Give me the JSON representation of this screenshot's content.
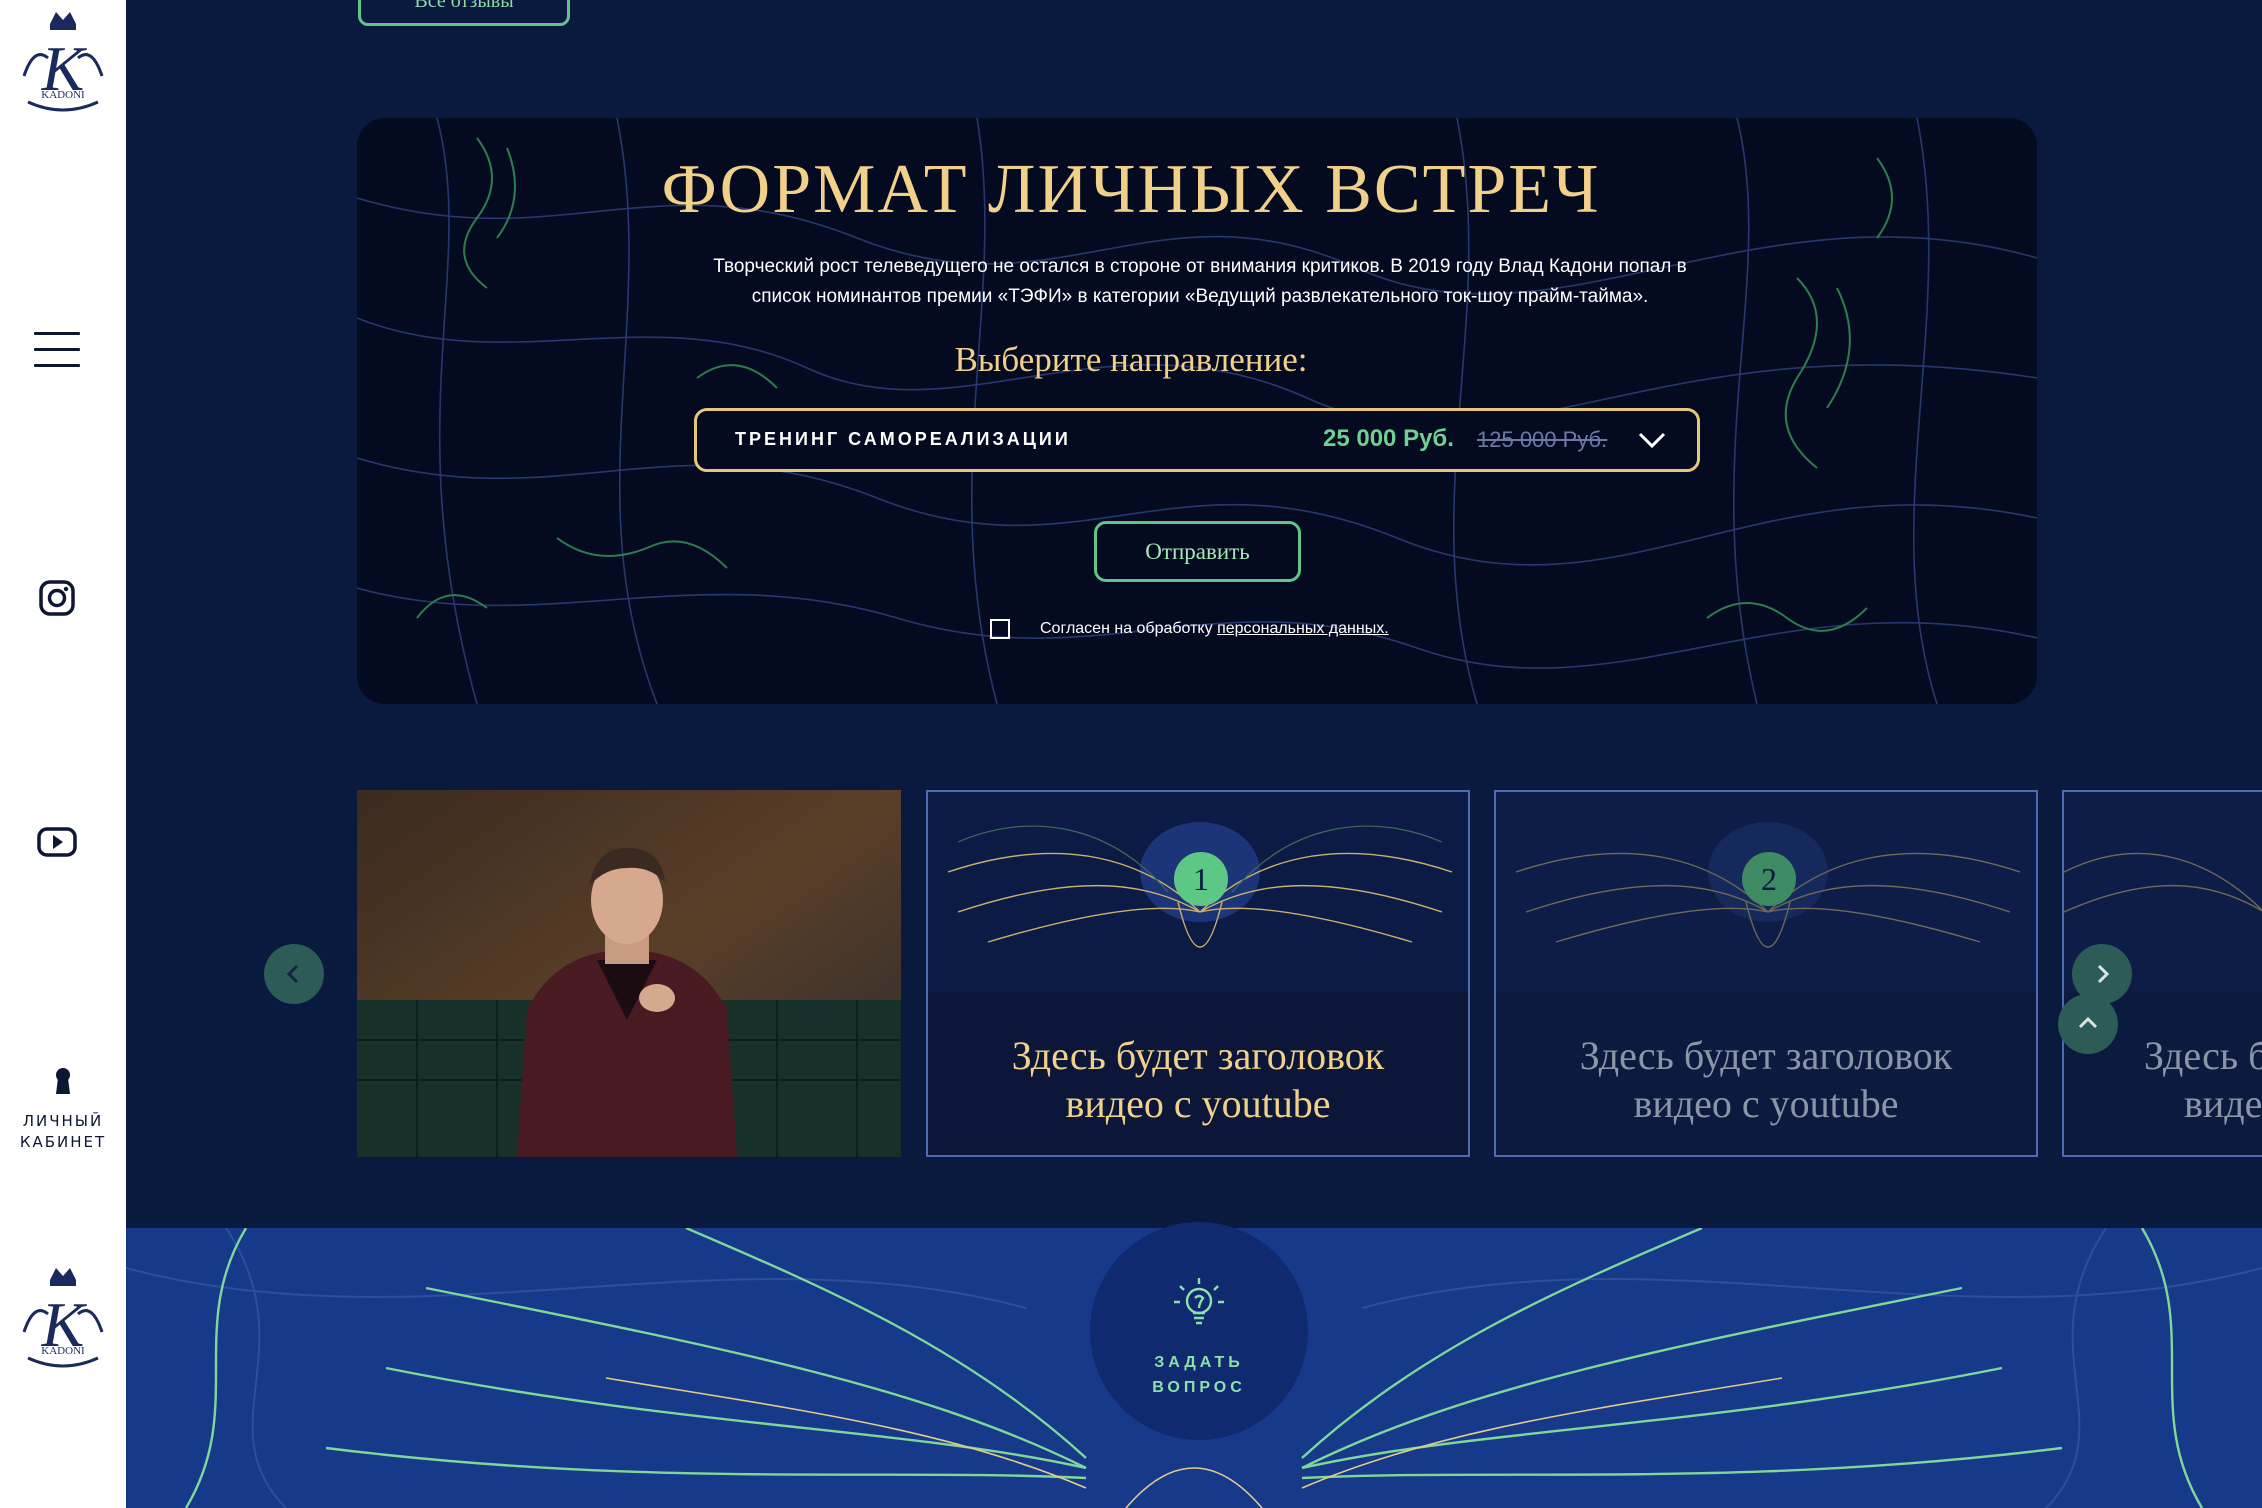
{
  "sidebar": {
    "logo_text": "KADONI",
    "cabinet_line1": "ЛИЧНЫЙ",
    "cabinet_line2": "КАБИНЕТ"
  },
  "reviews": {
    "all_label": "Все отзывы"
  },
  "format": {
    "title": "ФОРМАТ ЛИЧНЫХ ВСТРЕЧ",
    "description": "Творческий рост телеведущего не остался в стороне от внимания критиков. В 2019 году Влад Кадони попал в список номинантов премии «ТЭФИ» в категории «Ведущий развлекательного ток-шоу прайм-тайма».",
    "choose_label": "Выберите направление:",
    "selected_option": "ТРЕНИНГ САМОРЕАЛИЗАЦИИ",
    "price": "25 000 Руб.",
    "old_price": "125 000 Руб.",
    "submit_label": "Отправить",
    "consent_text": "Согласен на обработку ",
    "consent_link": "персональных данных."
  },
  "videos": [
    {
      "number": "1",
      "title_line1": "Здесь будет заголовок",
      "title_line2": "видео с youtube"
    },
    {
      "number": "2",
      "title_line1": "Здесь будет заголовок",
      "title_line2": "видео с youtube"
    },
    {
      "number": "",
      "title_line1": "Здесь б",
      "title_line2": "виде"
    }
  ],
  "ask": {
    "line1": "ЗАДАТЬ",
    "line2": "ВОПРОС"
  },
  "colors": {
    "page_bg": "#0a1a3f",
    "gold": "#f1d08a",
    "green": "#62c48a",
    "sidebar": "#ffffff"
  },
  "icons": [
    "hamburger-menu-icon",
    "instagram-icon",
    "youtube-icon",
    "keyhole-lock-icon",
    "chevron-down-icon",
    "arrow-left-icon",
    "arrow-right-icon",
    "arrow-up-icon",
    "lightbulb-icon"
  ]
}
